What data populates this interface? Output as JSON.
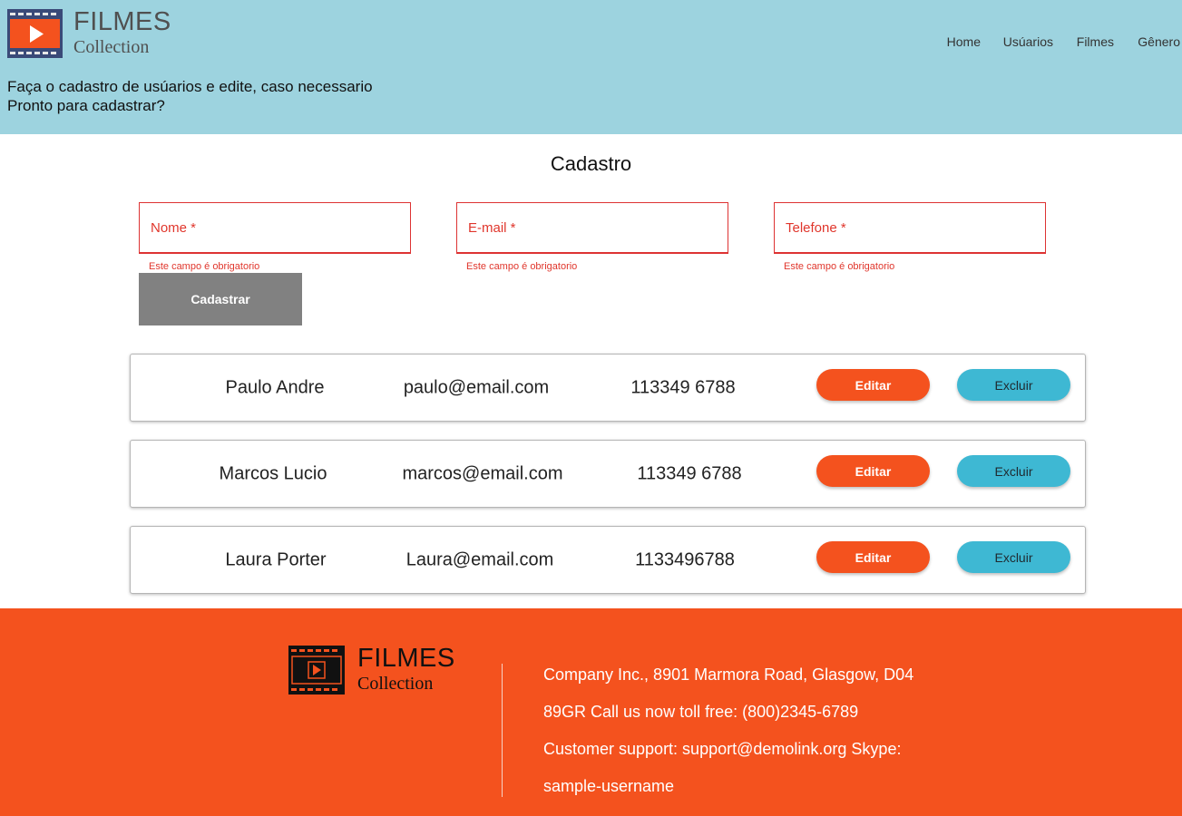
{
  "header": {
    "logo_title": "FILMES",
    "logo_subtitle": "Collection",
    "nav": [
      "Home",
      "Usúarios",
      "Filmes",
      "Gênero"
    ],
    "intro_line1": "Faça o cadastro de usúarios e edite, caso necessario",
    "intro_line2": "Pronto para cadastrar?"
  },
  "form": {
    "title": "Cadastro",
    "fields": [
      {
        "placeholder": "Nome *",
        "value": "",
        "error": "Este campo é obrigatorio"
      },
      {
        "placeholder": "E-mail *",
        "value": "",
        "error": "Este campo é obrigatorio"
      },
      {
        "placeholder": "Telefone *",
        "value": "",
        "error": "Este campo é obrigatorio"
      }
    ],
    "submit_label": "Cadastrar"
  },
  "users": [
    {
      "name": "Paulo Andre",
      "email": "paulo@email.com",
      "phone": "113349 6788",
      "edit_label": "Editar",
      "delete_label": "Excluir"
    },
    {
      "name": "Marcos Lucio",
      "email": "marcos@email.com",
      "phone": "113349 6788",
      "edit_label": "Editar",
      "delete_label": "Excluir"
    },
    {
      "name": "Laura Porter",
      "email": "Laura@email.com",
      "phone": "1133496788",
      "edit_label": "Editar",
      "delete_label": "Excluir"
    }
  ],
  "footer": {
    "logo_title": "FILMES",
    "logo_subtitle": "Collection",
    "contact_lines": [
      "Company Inc., 8901 Marmora Road, Glasgow, D04",
      "89GR Call us now toll free: (800)2345-6789",
      "Customer support: support@demolink.org Skype:",
      "sample-username"
    ]
  },
  "colors": {
    "header_bg": "#9dd3df",
    "footer_bg": "#f4521e",
    "edit_button": "#f4521e",
    "delete_button": "#3eb8d3",
    "submit_button": "#818181",
    "error": "#e0362c"
  },
  "icons": {
    "logo": "film-play-icon",
    "footer_logo": "film-play-icon"
  }
}
